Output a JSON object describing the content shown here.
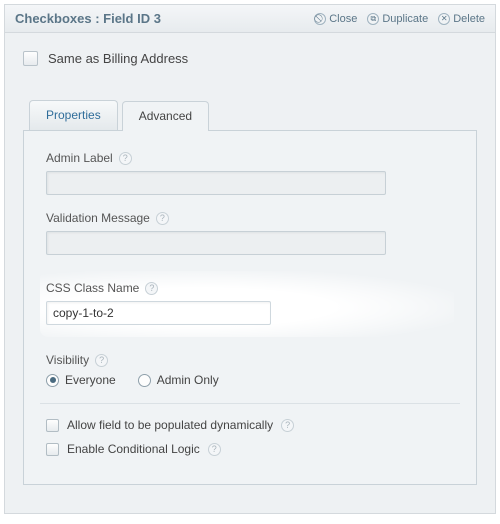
{
  "header": {
    "title": "Checkboxes : Field ID 3",
    "actions": {
      "close": "Close",
      "duplicate": "Duplicate",
      "delete": "Delete"
    }
  },
  "preview": {
    "label": "Same as Billing Address"
  },
  "tabs": {
    "properties": "Properties",
    "advanced": "Advanced"
  },
  "adv": {
    "admin_label": {
      "label": "Admin Label",
      "value": ""
    },
    "validation_msg": {
      "label": "Validation Message",
      "value": ""
    },
    "css_class": {
      "label": "CSS Class Name",
      "value": "copy-1-to-2"
    },
    "visibility": {
      "label": "Visibility",
      "options": {
        "everyone": "Everyone",
        "admin_only": "Admin Only"
      },
      "selected": "everyone"
    },
    "allow_populate": "Allow field to be populated dynamically",
    "cond_logic": "Enable Conditional Logic"
  },
  "glyphs": {
    "close": "⃠",
    "duplicate": "⧉",
    "delete": "✕",
    "help": "?"
  }
}
